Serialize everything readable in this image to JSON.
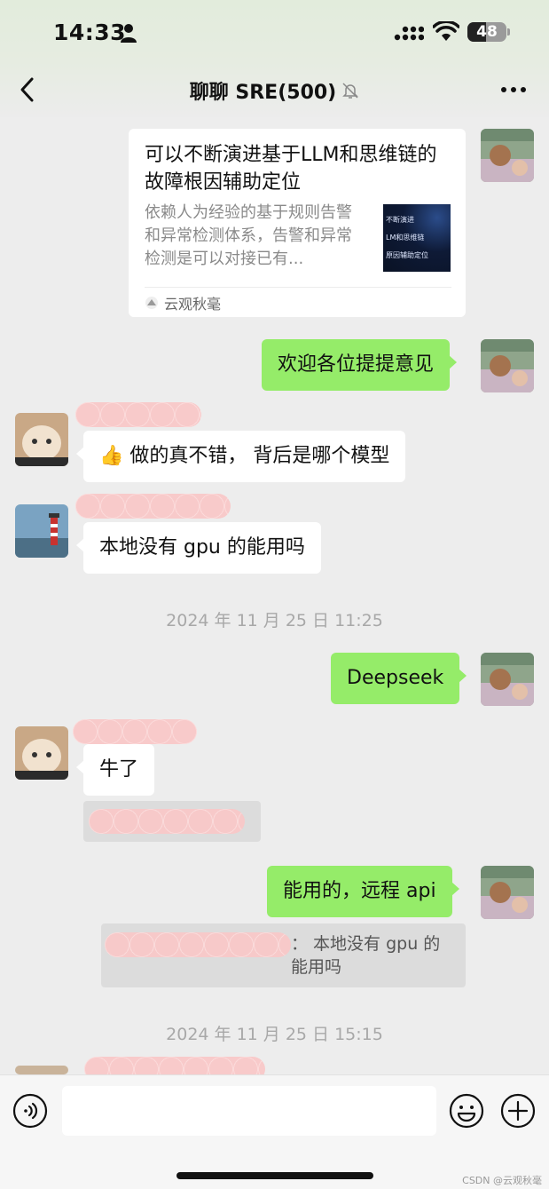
{
  "status_bar": {
    "time": "14:33",
    "battery": "48",
    "battery_level": 0.48
  },
  "nav": {
    "title": "聊聊 SRE(500)"
  },
  "card": {
    "title": "可以不断演进基于LLM和思维链的故障根因辅助定位",
    "description": "依赖人为经验的基于规则告警和异常检测体系，告警和异常检测是可以对接已有...",
    "thumb_lines": [
      "不断演进",
      "LM和思维链",
      "原因辅助定位"
    ],
    "source": "云观秋毫"
  },
  "messages": {
    "welcome": "欢迎各位提提意见",
    "thumbs_prefix": "👍",
    "q_model": "做的真不错， 背后是哪个模型",
    "q_gpu": "本地没有 gpu 的能用吗",
    "deepseek": "Deepseek",
    "niu": "牛了",
    "reply_remote": "能用的，远程 api",
    "reply_quote": "： 本地没有 gpu 的能用吗"
  },
  "timestamps": {
    "t1": "2024 年 11 月 25 日 11:25",
    "t2": "2024 年 11 月 25 日 15:15"
  },
  "footer": {
    "watermark": "CSDN @云观秋毫"
  },
  "icons": {
    "back": "chevron-left-icon",
    "mute": "bell-slash-icon",
    "more": "more-dots-icon",
    "voice": "voice-icon",
    "emoji": "emoji-icon",
    "plus": "plus-icon"
  },
  "colors": {
    "green_bubble": "#95ec69",
    "background": "#ededed"
  }
}
